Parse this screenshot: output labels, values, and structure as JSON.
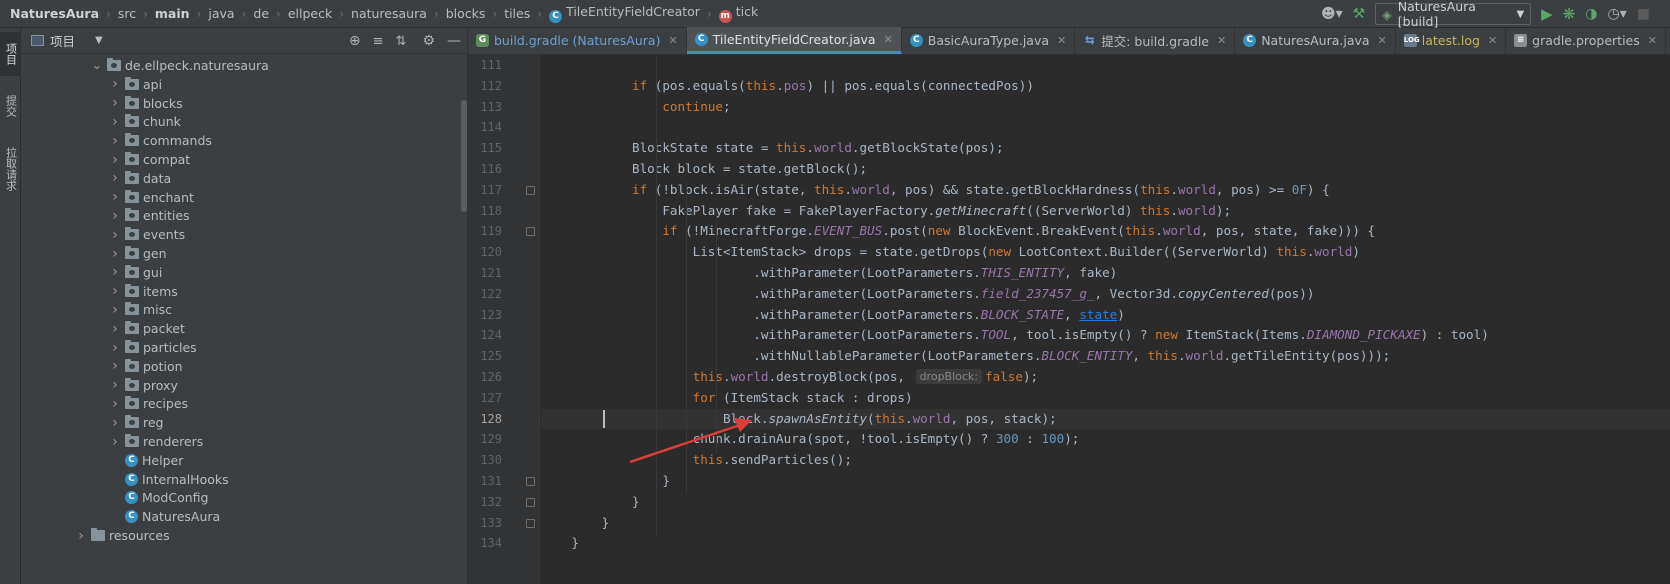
{
  "breadcrumb": {
    "items": [
      "NaturesAura",
      "src",
      "main",
      "java",
      "de",
      "ellpeck",
      "naturesaura",
      "blocks",
      "tiles",
      "TileEntityFieldCreator",
      "tick"
    ]
  },
  "toolbar": {
    "run_config": "NaturesAura [build]"
  },
  "left_strip": {
    "project_tab": "项目",
    "commit_tab": "提交",
    "pull_requests_tab": "拉取请求"
  },
  "project_panel": {
    "title": "项目",
    "tree": [
      {
        "label": "de.ellpeck.naturesaura",
        "kind": "package",
        "depth": 0,
        "expanded": true
      },
      {
        "label": "api",
        "kind": "package",
        "depth": 1
      },
      {
        "label": "blocks",
        "kind": "package",
        "depth": 1
      },
      {
        "label": "chunk",
        "kind": "package",
        "depth": 1
      },
      {
        "label": "commands",
        "kind": "package",
        "depth": 1
      },
      {
        "label": "compat",
        "kind": "package",
        "depth": 1
      },
      {
        "label": "data",
        "kind": "package",
        "depth": 1
      },
      {
        "label": "enchant",
        "kind": "package",
        "depth": 1
      },
      {
        "label": "entities",
        "kind": "package",
        "depth": 1
      },
      {
        "label": "events",
        "kind": "package",
        "depth": 1
      },
      {
        "label": "gen",
        "kind": "package",
        "depth": 1
      },
      {
        "label": "gui",
        "kind": "package",
        "depth": 1
      },
      {
        "label": "items",
        "kind": "package",
        "depth": 1
      },
      {
        "label": "misc",
        "kind": "package",
        "depth": 1
      },
      {
        "label": "packet",
        "kind": "package",
        "depth": 1
      },
      {
        "label": "particles",
        "kind": "package",
        "depth": 1
      },
      {
        "label": "potion",
        "kind": "package",
        "depth": 1
      },
      {
        "label": "proxy",
        "kind": "package",
        "depth": 1
      },
      {
        "label": "recipes",
        "kind": "package",
        "depth": 1
      },
      {
        "label": "reg",
        "kind": "package",
        "depth": 1
      },
      {
        "label": "renderers",
        "kind": "package",
        "depth": 1
      },
      {
        "label": "Helper",
        "kind": "class",
        "depth": 1
      },
      {
        "label": "InternalHooks",
        "kind": "class",
        "depth": 1
      },
      {
        "label": "ModConfig",
        "kind": "class",
        "depth": 1
      },
      {
        "label": "NaturesAura",
        "kind": "class",
        "depth": 1
      },
      {
        "label": "resources",
        "kind": "folder",
        "depth": -1
      }
    ]
  },
  "tabs": [
    {
      "label": "build.gradle (NaturesAura)",
      "icon": "gradle-icon",
      "kind": "gradle"
    },
    {
      "label": "TileEntityFieldCreator.java",
      "icon": "java-class-icon",
      "kind": "active"
    },
    {
      "label": "BasicAuraType.java",
      "icon": "java-class-icon",
      "kind": "normal"
    },
    {
      "label": "提交: build.gradle",
      "icon": "vcs-icon",
      "kind": "normal"
    },
    {
      "label": "NaturesAura.java",
      "icon": "java-class-icon",
      "kind": "normal"
    },
    {
      "label": "latest.log",
      "icon": "log-icon",
      "kind": "log"
    },
    {
      "label": "gradle.properties",
      "icon": "properties-icon",
      "kind": "normal"
    }
  ],
  "editor": {
    "current_line": 128,
    "lines": [
      {
        "n": 111,
        "html": ""
      },
      {
        "n": 112,
        "html": "            <span class=\"kw\">if</span> (pos.equals(<span class=\"kw\">this</span>.<span class=\"fld\">pos</span>) || pos.equals(connectedPos))"
      },
      {
        "n": 113,
        "html": "                <span class=\"kw\">continue</span>;"
      },
      {
        "n": 114,
        "html": ""
      },
      {
        "n": 115,
        "html": "            BlockState state = <span class=\"kw\">this</span>.<span class=\"fld\">world</span>.getBlockState(pos);"
      },
      {
        "n": 116,
        "html": "            Block block = state.getBlock();"
      },
      {
        "n": 117,
        "html": "            <span class=\"kw\">if</span> (!block.isAir(state, <span class=\"kw\">this</span>.<span class=\"fld\">world</span>, pos) &amp;&amp; state.getBlockHardness(<span class=\"kw\">this</span>.<span class=\"fld\">world</span>, pos) &gt;= <span class=\"num\">0F</span>) {"
      },
      {
        "n": 118,
        "html": "                FakePlayer fake = FakePlayerFactory.<span class=\"ital\">getMinecraft</span>((ServerWorld) <span class=\"kw\">this</span>.<span class=\"fld\">world</span>);"
      },
      {
        "n": 119,
        "html": "                <span class=\"kw\">if</span> (!MinecraftForge.<span class=\"ifld\">EVENT_BUS</span>.post(<span class=\"kw\">new</span> BlockEvent.BreakEvent(<span class=\"kw\">this</span>.<span class=\"fld\">world</span>, pos, state, fake))) {"
      },
      {
        "n": 120,
        "html": "                    List&lt;ItemStack&gt; drops = state.getDrops(<span class=\"kw\">new</span> LootContext.Builder((ServerWorld) <span class=\"kw\">this</span>.<span class=\"fld\">world</span>)"
      },
      {
        "n": 121,
        "html": "                            .withParameter(LootParameters.<span class=\"ifld\">THIS_ENTITY</span>, fake)"
      },
      {
        "n": 122,
        "html": "                            .withParameter(LootParameters.<span class=\"ifld\">field_237457_g_</span>, Vector3d.<span class=\"ital\">copyCentered</span>(pos))"
      },
      {
        "n": 123,
        "html": "                            .withParameter(LootParameters.<span class=\"ifld\">BLOCK_STATE</span>, <span class=\"lnk\">state</span>)"
      },
      {
        "n": 124,
        "html": "                            .withParameter(LootParameters.<span class=\"ifld\">TOOL</span>, tool.isEmpty() ? <span class=\"kw\">new</span> ItemStack(Items.<span class=\"ifld\">DIAMOND_PICKAXE</span>) : tool)"
      },
      {
        "n": 125,
        "html": "                            .withNullableParameter(LootParameters.<span class=\"ifld\">BLOCK_ENTITY</span>, <span class=\"kw\">this</span>.<span class=\"fld\">world</span>.getTileEntity(pos)));"
      },
      {
        "n": 126,
        "html": "                    <span class=\"kw\">this</span>.<span class=\"fld\">world</span>.destroyBlock(pos, <span class=\"hint\">dropBlock:</span><span class=\"kw\">false</span>);"
      },
      {
        "n": 127,
        "html": "                    <span class=\"kw\">for</span> (ItemStack stack : drops)"
      },
      {
        "n": 128,
        "html": "                        Block.<span class=\"ital\">spawnAsEntity</span>(<span class=\"kw\">this</span>.<span class=\"fld\">world</span>, pos, stack);"
      },
      {
        "n": 129,
        "html": "                    chunk.drainAura(spot, !tool.isEmpty() ? <span class=\"num\">300</span> : <span class=\"num\">100</span>);"
      },
      {
        "n": 130,
        "html": "                    <span class=\"kw\">this</span>.sendParticles();"
      },
      {
        "n": 131,
        "html": "                }"
      },
      {
        "n": 132,
        "html": "            }"
      },
      {
        "n": 133,
        "html": "        }"
      },
      {
        "n": 134,
        "html": "    }"
      }
    ],
    "fold_markers": [
      117,
      119,
      131,
      132,
      133
    ]
  },
  "colors": {
    "annotation_arrow": "#e03b3b",
    "active_tab_underline": "#4a88c7"
  }
}
